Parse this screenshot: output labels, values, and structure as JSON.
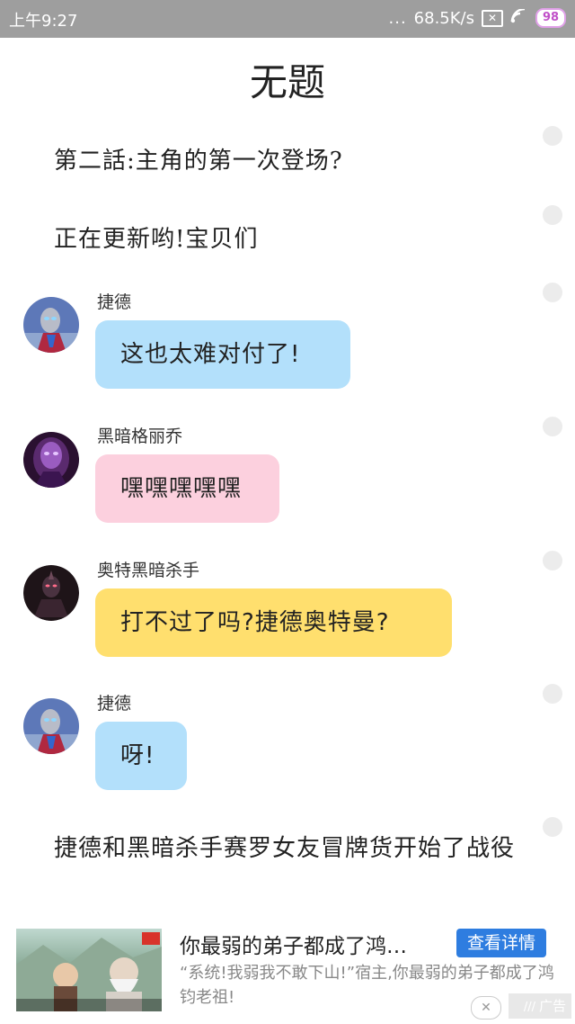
{
  "status_bar": {
    "time": "上午9:27",
    "dots": "...",
    "speed": "68.5K/s",
    "battery": "98"
  },
  "title": "无题",
  "narration": [
    "第二話:主角的第一次登场?",
    "正在更新哟!宝贝们"
  ],
  "messages": [
    {
      "speaker": "捷德",
      "text": "这也太难对付了!"
    },
    {
      "speaker": "黑暗格丽乔",
      "text": "嘿嘿嘿嘿嘿"
    },
    {
      "speaker": "奥特黑暗杀手",
      "text": "打不过了吗?捷德奥特曼?"
    },
    {
      "speaker": "捷德",
      "text": "呀!"
    }
  ],
  "paragraph": "捷德和黑暗杀手赛罗女友冒牌货开始了战役",
  "ad": {
    "title": "你最弱的弟子都成了鸿…",
    "button": "查看详情",
    "description": "“系统!我弱我不敢下山!”宿主,你最弱的弟子都成了鸿钧老祖!",
    "label": "广告"
  },
  "colors": {
    "bubble_blue": "#b3e0fb",
    "bubble_pink": "#fcd0de",
    "bubble_yellow": "#ffdf6e",
    "ad_button": "#2e7de0"
  }
}
